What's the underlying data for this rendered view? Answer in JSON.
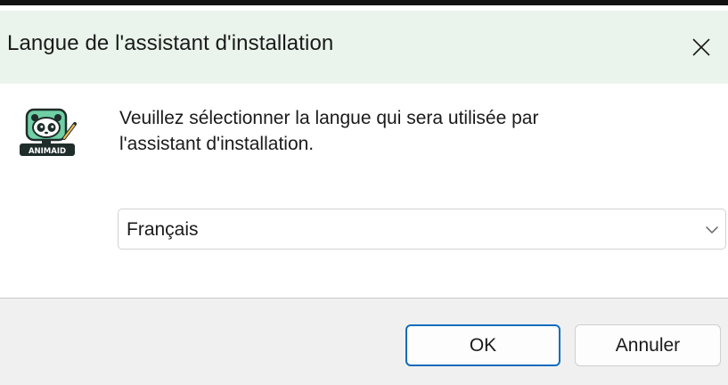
{
  "window": {
    "title": "Langue de l'assistant d'installation"
  },
  "content": {
    "prompt_line1": "Veuillez sélectionner la langue qui sera utilisée par",
    "prompt_line2": "l'assistant d'installation.",
    "app_icon": "animaid-panda-logo",
    "app_icon_text": "ANIMAID"
  },
  "language_select": {
    "selected_value": "Français"
  },
  "footer": {
    "ok_label": "OK",
    "cancel_label": "Annuler"
  },
  "colors": {
    "titlebar_bg": "#eaf4ec",
    "footer_bg": "#f0f0f0",
    "accent": "#0f6cbd"
  }
}
